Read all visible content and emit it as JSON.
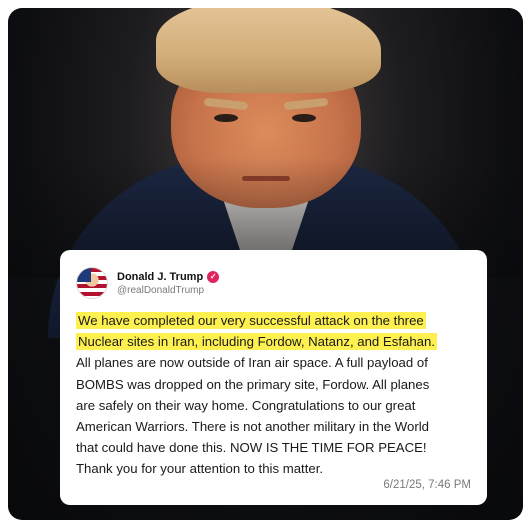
{
  "post": {
    "author_name": "Donald J. Trump",
    "handle": "@realDonaldTrump",
    "verified_mark": "✓",
    "highlighted_lines": [
      "We have completed our very successful attack on the three",
      "Nuclear sites in Iran, including Fordow, Natanz, and Esfahan."
    ],
    "body_lines": [
      "All planes are now outside of Iran air space. A full payload of",
      "BOMBS was dropped on the primary site, Fordow. All planes",
      "are safely on their way home. Congratulations to our great",
      "American Warriors. There is not another military in the World",
      "that could have done this. NOW IS THE TIME FOR PEACE!",
      "Thank you for your attention to this matter."
    ],
    "timestamp": "6/21/25, 7:46 PM"
  },
  "colors": {
    "highlight": "#fdf04f",
    "verified_badge": "#e0245e",
    "background": "#0c0d10"
  },
  "icons": {
    "verified": "verified-badge-icon"
  }
}
